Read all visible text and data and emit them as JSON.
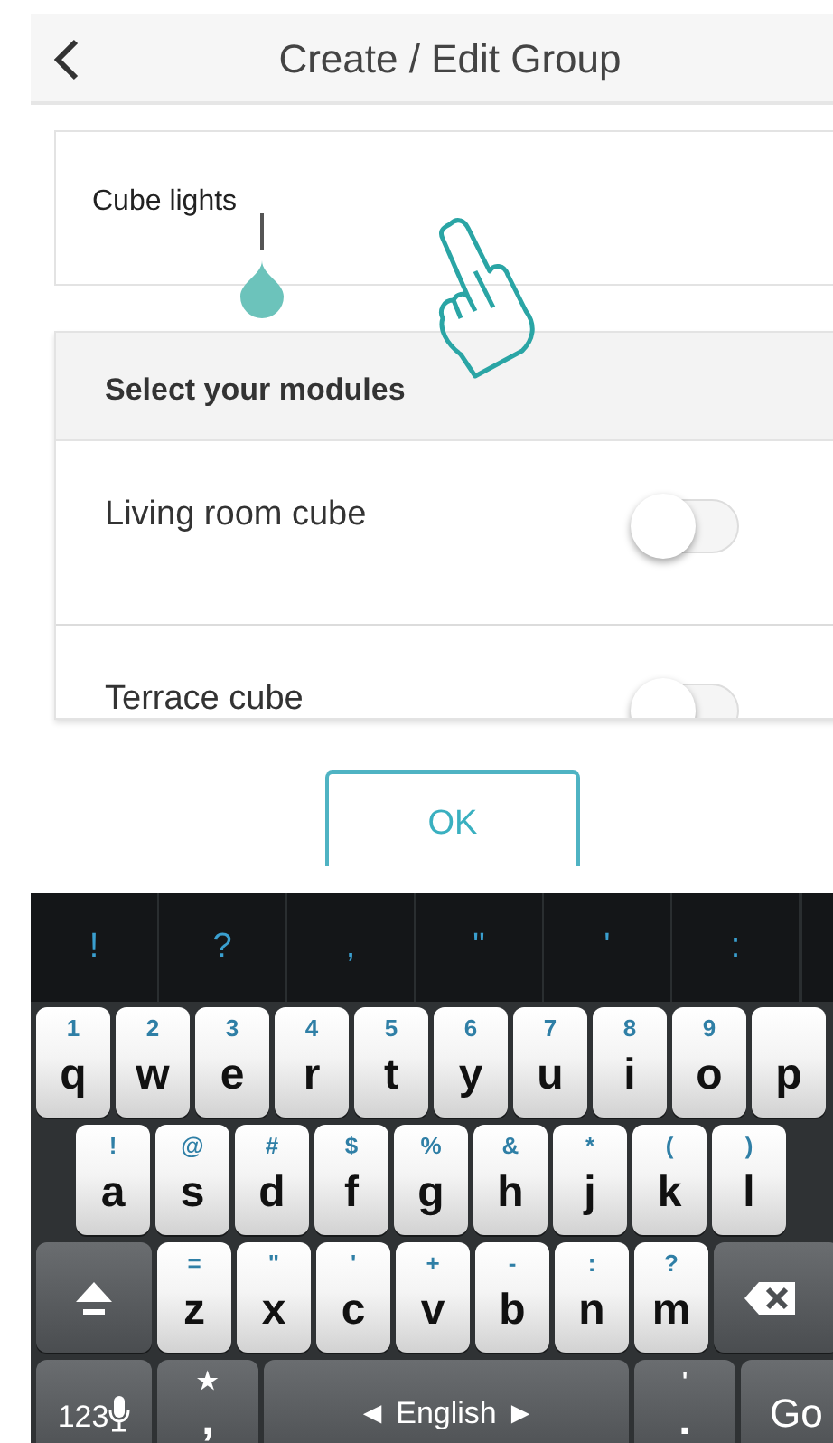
{
  "header": {
    "title": "Create / Edit Group"
  },
  "name_field": {
    "value": "Cube lights"
  },
  "modules": {
    "title": "Select your modules",
    "items": [
      {
        "name": "Living room cube",
        "on": false
      },
      {
        "name": "Terrace cube",
        "on": false
      }
    ]
  },
  "ok_button": "OK",
  "keyboard": {
    "suggestions": [
      "!",
      "?",
      ",",
      "\"",
      "'",
      ":"
    ],
    "rows": [
      {
        "keys": [
          {
            "kind": "letter",
            "label": "q",
            "hint": "1"
          },
          {
            "kind": "letter",
            "label": "w",
            "hint": "2"
          },
          {
            "kind": "letter",
            "label": "e",
            "hint": "3"
          },
          {
            "kind": "letter",
            "label": "r",
            "hint": "4"
          },
          {
            "kind": "letter",
            "label": "t",
            "hint": "5"
          },
          {
            "kind": "letter",
            "label": "y",
            "hint": "6"
          },
          {
            "kind": "letter",
            "label": "u",
            "hint": "7"
          },
          {
            "kind": "letter",
            "label": "i",
            "hint": "8"
          },
          {
            "kind": "letter",
            "label": "o",
            "hint": "9"
          },
          {
            "kind": "letter",
            "label": "p"
          }
        ]
      },
      {
        "keys": [
          {
            "kind": "letter",
            "label": "a",
            "hint": "!"
          },
          {
            "kind": "letter",
            "label": "s",
            "hint": "@"
          },
          {
            "kind": "letter",
            "label": "d",
            "hint": "#"
          },
          {
            "kind": "letter",
            "label": "f",
            "hint": "$"
          },
          {
            "kind": "letter",
            "label": "g",
            "hint": "%"
          },
          {
            "kind": "letter",
            "label": "h",
            "hint": "&"
          },
          {
            "kind": "letter",
            "label": "j",
            "hint": "*"
          },
          {
            "kind": "letter",
            "label": "k",
            "hint": "("
          },
          {
            "kind": "letter",
            "label": "l",
            "hint": ")"
          }
        ]
      },
      {
        "keys": [
          {
            "kind": "shift"
          },
          {
            "kind": "letter",
            "label": "z",
            "hint": "="
          },
          {
            "kind": "letter",
            "label": "x",
            "hint": "\""
          },
          {
            "kind": "letter",
            "label": "c",
            "hint": "'"
          },
          {
            "kind": "letter",
            "label": "v",
            "hint": "+"
          },
          {
            "kind": "letter",
            "label": "b",
            "hint": "-"
          },
          {
            "kind": "letter",
            "label": "n",
            "hint": ":"
          },
          {
            "kind": "letter",
            "label": "m",
            "hint": "?"
          },
          {
            "kind": "delete"
          }
        ]
      },
      {
        "keys": [
          {
            "kind": "mode",
            "label": "123"
          },
          {
            "kind": "comma",
            "label": ",",
            "hint": "★"
          },
          {
            "kind": "space",
            "label": "◄ English ►"
          },
          {
            "kind": "period",
            "label": ".",
            "hint": "'"
          },
          {
            "kind": "go",
            "label": "Go"
          }
        ]
      }
    ]
  }
}
